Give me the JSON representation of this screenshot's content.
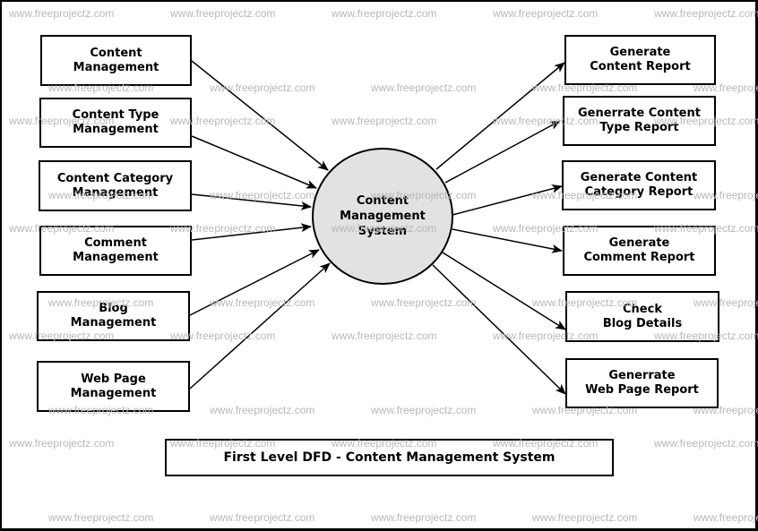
{
  "diagram": {
    "title": "First Level DFD - Content Management System",
    "central_process": "Content\nManagement\nSystem",
    "inputs": [
      {
        "id": "content-management",
        "label": "Content\nManagement"
      },
      {
        "id": "content-type-management",
        "label": "Content Type\nManagement"
      },
      {
        "id": "content-category-management",
        "label": "Content Category\nManagement"
      },
      {
        "id": "comment-management",
        "label": "Comment\nManagement"
      },
      {
        "id": "blog-management",
        "label": "Blog\nManagement"
      },
      {
        "id": "web-page-management",
        "label": "Web Page\nManagement"
      }
    ],
    "outputs": [
      {
        "id": "generate-content-report",
        "label": "Generate\nContent Report"
      },
      {
        "id": "generrate-content-type-report",
        "label": "Generrate Content\nType Report"
      },
      {
        "id": "generate-content-category-report",
        "label": "Generate Content\nCategory Report"
      },
      {
        "id": "generate-comment-report",
        "label": "Generate\nComment Report"
      },
      {
        "id": "check-blog-details",
        "label": "Check\nBlog Details"
      },
      {
        "id": "generrate-web-page-report",
        "label": "Generrate\nWeb Page Report"
      }
    ],
    "watermark": "www.freeprojectz.com",
    "colors": {
      "process_fill": "#e2e2e2",
      "line": "#000000",
      "watermark": "#b8b8b8"
    }
  }
}
